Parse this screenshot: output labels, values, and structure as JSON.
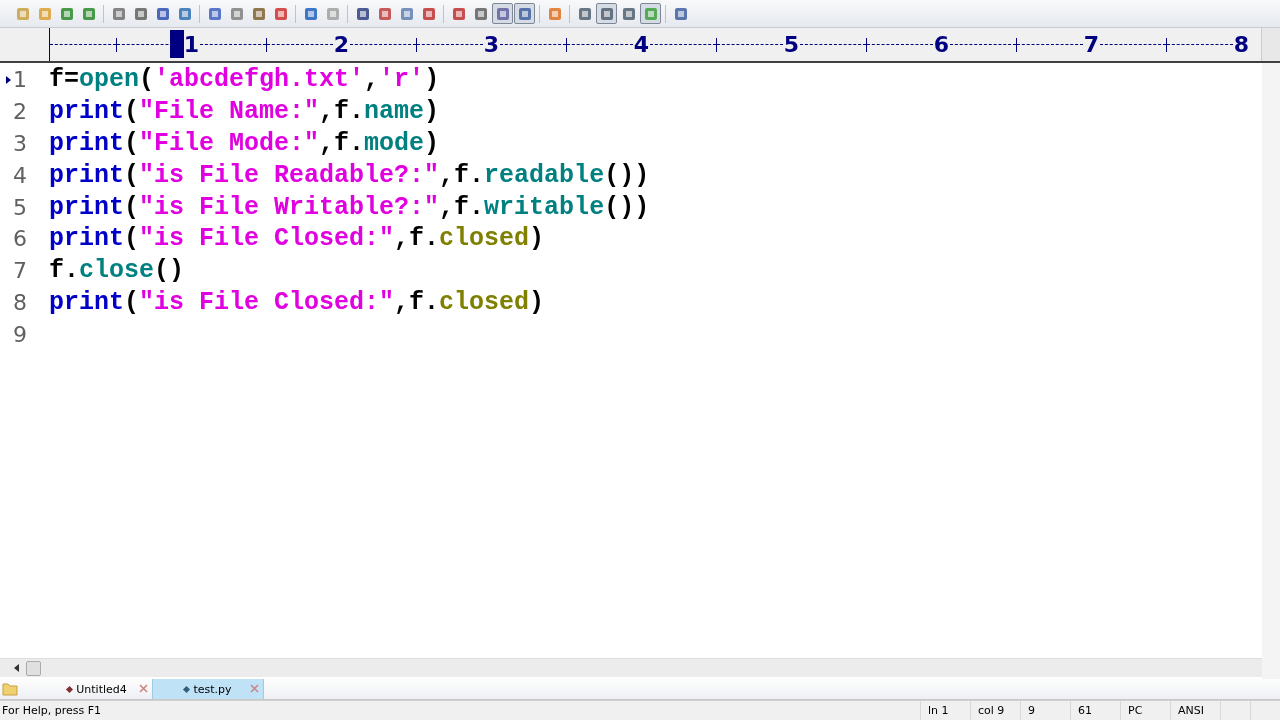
{
  "toolbar": [
    {
      "pressed": false
    },
    {
      "pressed": false
    },
    {
      "pressed": false
    },
    {
      "pressed": false
    },
    {
      "pressed": false
    },
    {
      "pressed": false
    },
    {
      "pressed": false
    },
    {
      "pressed": false
    },
    {
      "pressed": false
    },
    {
      "pressed": false
    },
    {
      "pressed": false
    },
    {
      "pressed": false
    },
    {
      "pressed": false
    },
    {
      "pressed": false
    },
    {
      "pressed": false
    },
    {
      "pressed": false
    },
    {
      "pressed": false
    },
    {
      "pressed": false
    },
    {
      "pressed": false
    },
    {
      "pressed": false
    },
    {
      "pressed": true
    },
    {
      "pressed": true
    },
    {
      "pressed": false
    },
    {
      "pressed": false
    },
    {
      "pressed": true
    },
    {
      "pressed": false
    },
    {
      "pressed": true
    },
    {
      "pressed": false
    }
  ],
  "ruler": {
    "marks": [
      "1",
      "2",
      "3",
      "4",
      "5",
      "6",
      "7",
      "8"
    ]
  },
  "editor": {
    "lines": [
      {
        "number": "1",
        "current": true,
        "tokens": [
          {
            "kind": "plain",
            "text": "f="
          },
          {
            "kind": "builtin",
            "text": "open"
          },
          {
            "kind": "plain",
            "text": "("
          },
          {
            "kind": "string",
            "text": "'abcdefgh.txt'"
          },
          {
            "kind": "plain",
            "text": ","
          },
          {
            "kind": "string",
            "text": "'r'"
          },
          {
            "kind": "plain",
            "text": ")"
          }
        ]
      },
      {
        "number": "2",
        "current": false,
        "tokens": [
          {
            "kind": "keyword",
            "text": "print"
          },
          {
            "kind": "plain",
            "text": "("
          },
          {
            "kind": "string",
            "text": "\"File Name:\""
          },
          {
            "kind": "plain",
            "text": ",f."
          },
          {
            "kind": "builtin",
            "text": "name"
          },
          {
            "kind": "plain",
            "text": ")"
          }
        ]
      },
      {
        "number": "3",
        "current": false,
        "tokens": [
          {
            "kind": "keyword",
            "text": "print"
          },
          {
            "kind": "plain",
            "text": "("
          },
          {
            "kind": "string",
            "text": "\"File Mode:\""
          },
          {
            "kind": "plain",
            "text": ",f."
          },
          {
            "kind": "builtin",
            "text": "mode"
          },
          {
            "kind": "plain",
            "text": ")"
          }
        ]
      },
      {
        "number": "4",
        "current": false,
        "tokens": [
          {
            "kind": "keyword",
            "text": "print"
          },
          {
            "kind": "plain",
            "text": "("
          },
          {
            "kind": "string",
            "text": "\"is File Readable?:\""
          },
          {
            "kind": "plain",
            "text": ",f."
          },
          {
            "kind": "builtin",
            "text": "readable"
          },
          {
            "kind": "plain",
            "text": "())"
          }
        ]
      },
      {
        "number": "5",
        "current": false,
        "tokens": [
          {
            "kind": "keyword",
            "text": "print"
          },
          {
            "kind": "plain",
            "text": "("
          },
          {
            "kind": "string",
            "text": "\"is File Writable?:\""
          },
          {
            "kind": "plain",
            "text": ",f."
          },
          {
            "kind": "builtin",
            "text": "writable"
          },
          {
            "kind": "plain",
            "text": "())"
          }
        ]
      },
      {
        "number": "6",
        "current": false,
        "tokens": [
          {
            "kind": "keyword",
            "text": "print"
          },
          {
            "kind": "plain",
            "text": "("
          },
          {
            "kind": "string",
            "text": "\"is File Closed:\""
          },
          {
            "kind": "plain",
            "text": ",f."
          },
          {
            "kind": "attr",
            "text": "closed"
          },
          {
            "kind": "plain",
            "text": ")"
          }
        ]
      },
      {
        "number": "7",
        "current": false,
        "tokens": [
          {
            "kind": "plain",
            "text": "f."
          },
          {
            "kind": "builtin",
            "text": "close"
          },
          {
            "kind": "plain",
            "text": "()"
          }
        ]
      },
      {
        "number": "8",
        "current": false,
        "tokens": [
          {
            "kind": "keyword",
            "text": "print"
          },
          {
            "kind": "plain",
            "text": "("
          },
          {
            "kind": "string",
            "text": "\"is File Closed:\""
          },
          {
            "kind": "plain",
            "text": ",f."
          },
          {
            "kind": "attr",
            "text": "closed"
          },
          {
            "kind": "plain",
            "text": ")"
          }
        ]
      },
      {
        "number": "9",
        "current": false
      }
    ]
  },
  "tabs": [
    {
      "label": "Untitled4",
      "selected": false
    },
    {
      "label": "test.py",
      "selected": true
    }
  ],
  "status_bar": {
    "help": "For Help, press F1",
    "cells": [
      "ln 1",
      "col 9",
      "9",
      "61",
      "PC",
      "ANSI"
    ]
  }
}
